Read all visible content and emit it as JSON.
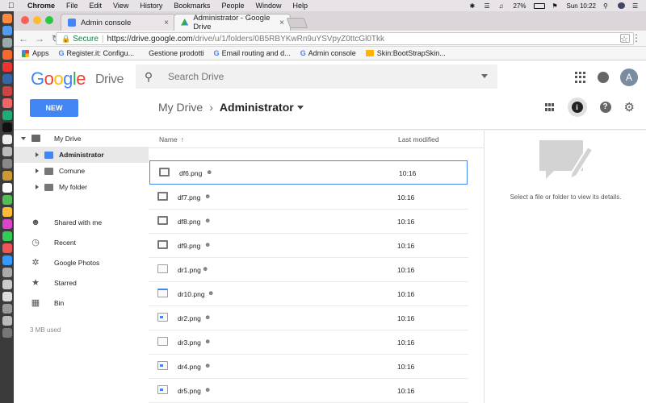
{
  "menubar": {
    "app": "Chrome",
    "items": [
      "File",
      "Edit",
      "View",
      "History",
      "Bookmarks",
      "People",
      "Window",
      "Help"
    ],
    "battery": "27%",
    "clock": "Sun 10:22"
  },
  "tabs": [
    {
      "title": "Admin console",
      "active": false
    },
    {
      "title": "Administrator - Google Drive",
      "active": true
    }
  ],
  "omnibox": {
    "secure_label": "Secure",
    "url_host": "https://drive.google.com",
    "url_path": "/drive/u/1/folders/0B5RBYKwRn9uYSVpyZ0ttcGl0Tkk"
  },
  "bookmarks": [
    {
      "label": "Apps",
      "icon": "apps-grid-icon"
    },
    {
      "label": "Register.it: Configu...",
      "icon": "google-icon"
    },
    {
      "label": "Gestione prodotti",
      "icon": "none"
    },
    {
      "label": "Email routing and d...",
      "icon": "google-icon"
    },
    {
      "label": "Admin console",
      "icon": "google-icon"
    },
    {
      "label": "Skin:BootStrapSkin...",
      "icon": "folder-icon"
    }
  ],
  "drive": {
    "product": "Drive",
    "search_placeholder": "Search Drive",
    "avatar_letter": "A",
    "new_label": "NEW",
    "breadcrumb": {
      "root": "My Drive",
      "current": "Administrator"
    }
  },
  "sidebar": {
    "items": [
      {
        "label": "My Drive"
      },
      {
        "label": "Administrator"
      },
      {
        "label": "Comune"
      },
      {
        "label": "My folder"
      },
      {
        "label": "Shared with me"
      },
      {
        "label": "Recent"
      },
      {
        "label": "Google Photos"
      },
      {
        "label": "Starred"
      },
      {
        "label": "Bin"
      }
    ],
    "storage": "3 MB used"
  },
  "list": {
    "col_name": "Name",
    "col_modified": "Last modified",
    "files": [
      {
        "name": "df6.png",
        "modified": "10:16"
      },
      {
        "name": "df7.png",
        "modified": "10:16"
      },
      {
        "name": "df8.png",
        "modified": "10:16"
      },
      {
        "name": "df9.png",
        "modified": "10:16"
      },
      {
        "name": "dr1.png",
        "modified": "10:16"
      },
      {
        "name": "dr10.png",
        "modified": "10:16"
      },
      {
        "name": "dr2.png",
        "modified": "10:16"
      },
      {
        "name": "dr3.png",
        "modified": "10:16"
      },
      {
        "name": "dr4.png",
        "modified": "10:16"
      },
      {
        "name": "dr5.png",
        "modified": "10:16"
      }
    ]
  },
  "details": {
    "empty_text": "Select a file or folder to view its details."
  }
}
